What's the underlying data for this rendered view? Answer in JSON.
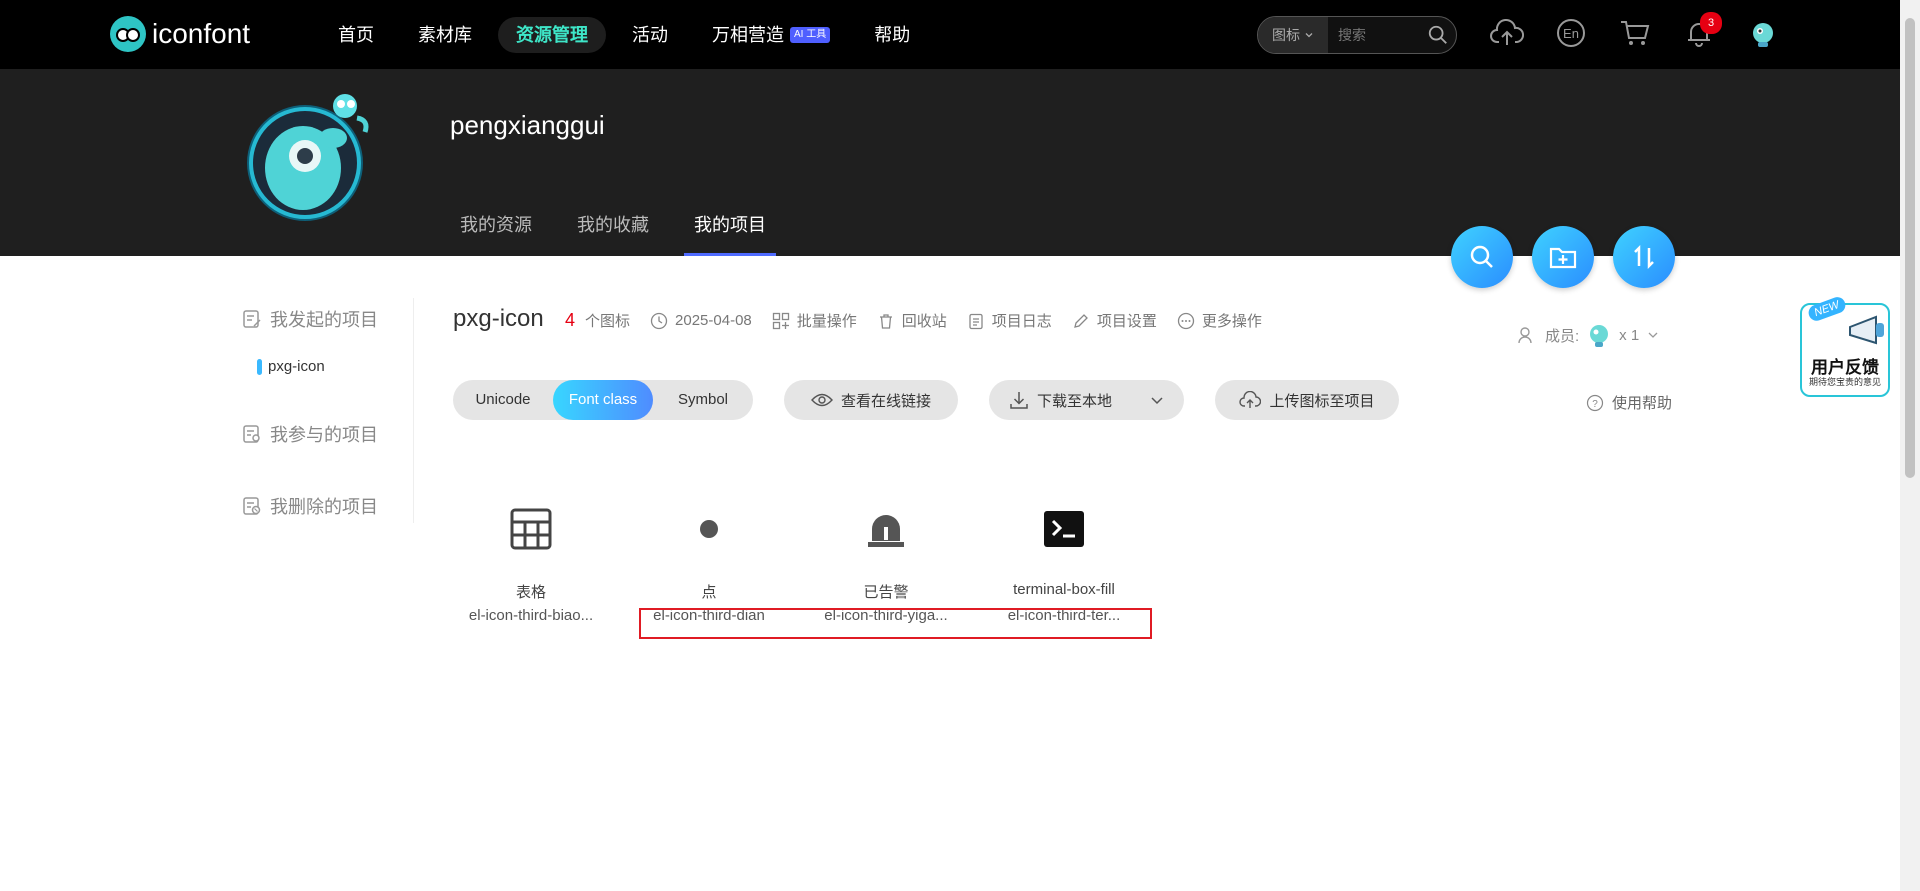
{
  "topbar": {
    "logo_text": "iconfont",
    "nav": [
      {
        "label": "首页"
      },
      {
        "label": "素材库"
      },
      {
        "label": "资源管理"
      },
      {
        "label": "活动"
      },
      {
        "label": "万相营造",
        "badge": "AI 工具"
      },
      {
        "label": "帮助"
      }
    ],
    "search": {
      "type": "图标",
      "placeholder": "搜索"
    },
    "notification_count": "3"
  },
  "profile": {
    "username": "pengxianggui",
    "tabs": [
      {
        "label": "我的资源"
      },
      {
        "label": "我的收藏"
      },
      {
        "label": "我的项目"
      }
    ]
  },
  "sidebar": {
    "groups": [
      {
        "label": "我发起的项目"
      },
      {
        "label": "我参与的项目"
      },
      {
        "label": "我删除的项目"
      }
    ],
    "projects": [
      {
        "label": "pxg-icon"
      }
    ]
  },
  "project": {
    "title": "pxg-icon",
    "count": "4",
    "count_label": "个图标",
    "date": "2025-04-08",
    "actions": [
      "批量操作",
      "回收站",
      "项目日志",
      "项目设置",
      "更多操作"
    ],
    "members_label": "成员:",
    "members_count": "x 1"
  },
  "toolbar": {
    "modes": [
      "Unicode",
      "Font class",
      "Symbol"
    ],
    "active_mode": "Font class",
    "view_online": "查看在线链接",
    "download": "下载至本地",
    "upload": "上传图标至项目",
    "help": "使用帮助"
  },
  "icons": [
    {
      "name": "表格",
      "class": "el-icon-third-biao...",
      "glyph": "table-icon"
    },
    {
      "name": "点",
      "class": "el-icon-third-dian",
      "glyph": "dot-icon"
    },
    {
      "name": "已告警",
      "class": "el-icon-third-yiga...",
      "glyph": "alarm-siren-icon"
    },
    {
      "name": "terminal-box-fill",
      "class": "el-icon-third-ter...",
      "glyph": "terminal-box-icon"
    }
  ],
  "feedback": {
    "badge": "NEW",
    "title": "用户反馈",
    "subtitle": "期待您宝贵的意见"
  },
  "colors": {
    "accent": "#3ee6c8",
    "brand_gradient_start": "#38d6ff",
    "brand_gradient_end": "#4f8cff",
    "alert": "#e60012",
    "highlight_box": "#e01b24"
  }
}
